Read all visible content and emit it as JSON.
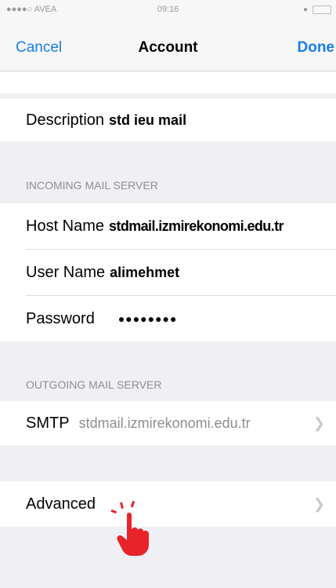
{
  "status_bar": {
    "carrier": "●●●●○ AVEA",
    "time": "09:16"
  },
  "nav": {
    "cancel_label": "Cancel",
    "title": "Account",
    "done_label": "Done"
  },
  "description": {
    "label": "Description",
    "value": "std ieu mail"
  },
  "incoming": {
    "header": "INCOMING MAIL SERVER",
    "host_label": "Host Name",
    "host_value": "stdmail.izmirekonomi.edu.tr",
    "user_label": "User Name",
    "user_value": "alimehmet",
    "password_label": "Password",
    "password_value": "●●●●●●●●"
  },
  "outgoing": {
    "header": "OUTGOING MAIL SERVER",
    "smtp_label": "SMTP",
    "smtp_value": "stdmail.izmirekonomi.edu.tr"
  },
  "advanced": {
    "label": "Advanced"
  },
  "colors": {
    "accent": "#1a7ee6",
    "pointer": "#e8242a"
  }
}
